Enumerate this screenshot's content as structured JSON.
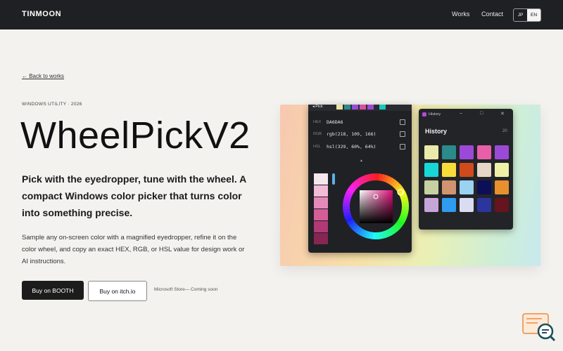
{
  "nav": {
    "brand": "TINMOON",
    "works": "Works",
    "contact": "Contact",
    "lang_jp": "JP",
    "lang_en": "EN"
  },
  "back": "← Back to works",
  "eyebrow": "WINDOWS UTILITY · 2026",
  "title": "WheelPickV2",
  "lead": "Pick with the eyedropper, tune with the wheel. A compact Windows color picker that turns color into something precise.",
  "description": "Sample any on-screen color with a magnified eyedropper, refine it on the color wheel, and copy an exact HEX, RGB, or HSL value for design work or AI instructions.",
  "buttons": {
    "booth": "Buy on BOOTH",
    "itch": "Buy on itch.io",
    "store": "Microsoft Store— Coming soon"
  },
  "picker": {
    "tab": "Pick",
    "top_swatches": [
      "#e9e4a6",
      "#2b8a8a",
      "#9b4ad8",
      "#d84fa3",
      "#9b4ad8",
      "#15c9c0"
    ],
    "hex_label": "HEX",
    "hex_value": "DA6DA6",
    "rgb_label": "RGB",
    "rgb_value": "rgb(218, 109, 166)",
    "hsl_label": "HSL",
    "hsl_value": "hsl(329, 60%, 64%)",
    "caret": "▲",
    "palette": [
      "#f6e6ee",
      "#f0bcd6",
      "#e58ab8",
      "#d45d98",
      "#b13a76",
      "#872652"
    ],
    "selected_color": "#da6da6"
  },
  "history": {
    "window_title": "History",
    "heading": "History",
    "count": "20",
    "minimize": "–",
    "maximize": "□",
    "close": "✕",
    "swatches": [
      "#eaeaaa",
      "#2b8a8a",
      "#9b4ad8",
      "#e65fa8",
      "#9b4ad8",
      "#18d8d6",
      "#f8dc3a",
      "#cf4a1c",
      "#e6d6c6",
      "#eef0a8",
      "#c6d0a0",
      "#d09470",
      "#9ad2f2",
      "#0c0e58",
      "#e8902e",
      "#c6a6d8",
      "#2e9cf0",
      "#dadcf2",
      "#2c349e",
      "#66141e"
    ]
  },
  "colors": {
    "nav_bg": "#1f2023",
    "page_bg": "#f3f2ef",
    "button_dark": "#1c1c1c",
    "accent_magenta": "#da6da6"
  },
  "icons": {
    "copy": "copy-icon",
    "logo": "search-magnifier-logo"
  }
}
